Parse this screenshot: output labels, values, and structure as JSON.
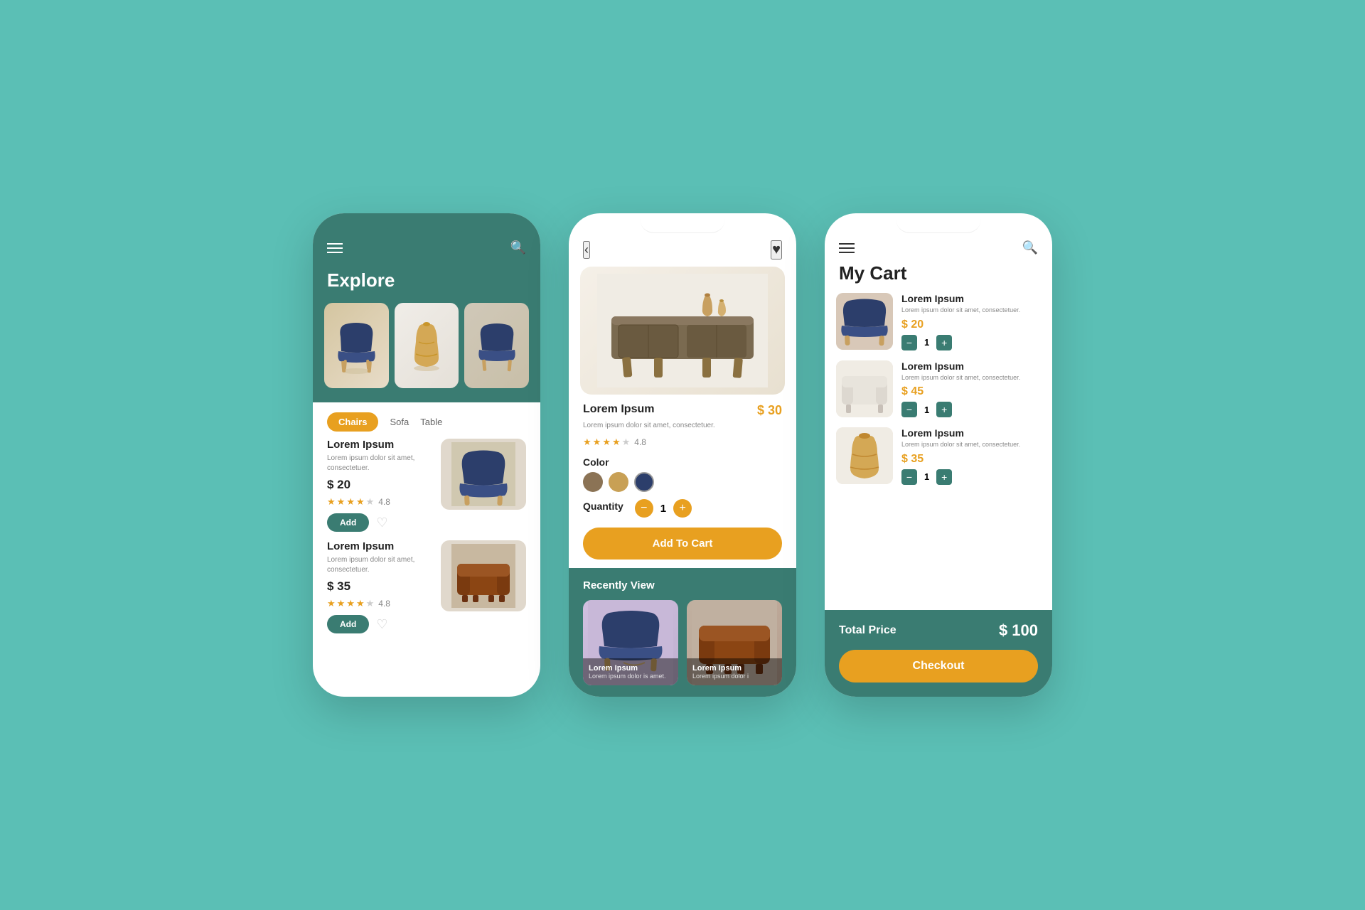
{
  "app": {
    "bg_color": "#5bbfb5",
    "teal": "#3a7c72",
    "orange": "#e8a020"
  },
  "phone1": {
    "title": "Explore",
    "categories": [
      "Chairs",
      "Sofa",
      "Table"
    ],
    "products": [
      {
        "name": "Lorem Ipsum",
        "desc": "Lorem ipsum dolor sit amet, consectetuer.",
        "price": "$ 20",
        "rating": "4.8",
        "stars": 4
      },
      {
        "name": "Lorem Ipsum",
        "desc": "Lorem ipsum dolor sit amet, consectetuer.",
        "price": "$ 35",
        "rating": "4.8",
        "stars": 4
      }
    ]
  },
  "phone2": {
    "product_name": "Lorem Ipsum",
    "product_desc": "Lorem ipsum dolor sit amet, consectetuer.",
    "product_price": "$ 30",
    "rating": "4.8",
    "stars": 4,
    "color_label": "Color",
    "quantity_label": "Quantity",
    "quantity": "1",
    "add_to_cart": "Add To Cart",
    "recently_view": "Recently View",
    "recently_items": [
      {
        "name": "Lorem Ipsum",
        "desc": "Lorem ipsum dolor is amet."
      },
      {
        "name": "Lorem Ipsum",
        "desc": "Lorem ipsum dolor i"
      }
    ]
  },
  "phone3": {
    "title": "My Cart",
    "items": [
      {
        "name": "Lorem Ipsum",
        "desc": "Lorem ipsum dolor sit amet, consectetuer.",
        "price": "$ 20",
        "qty": "1"
      },
      {
        "name": "Lorem Ipsum",
        "desc": "Lorem ipsum dolor sit amet, consectetuer.",
        "price": "$ 45",
        "qty": "1"
      },
      {
        "name": "Lorem Ipsum",
        "desc": "Lorem ipsum dolor sit amet, consectetuer.",
        "price": "$ 35",
        "qty": "1"
      }
    ],
    "total_label": "Total Price",
    "total_price": "$ 100",
    "checkout": "Checkout"
  }
}
